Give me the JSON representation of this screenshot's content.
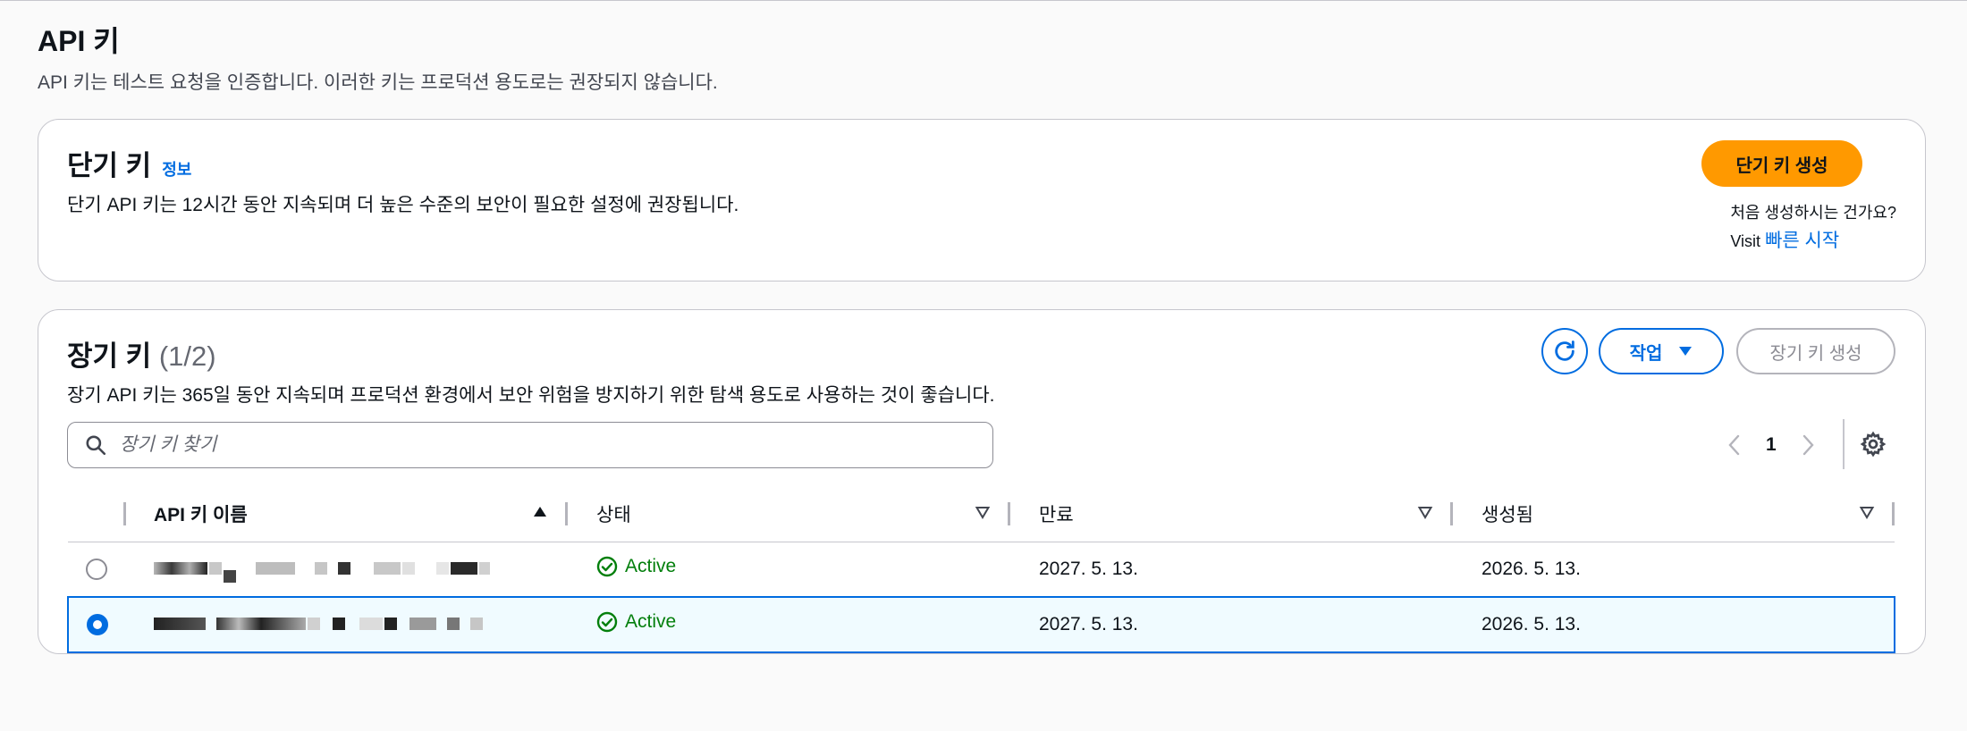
{
  "page": {
    "title": "API 키",
    "description": "API 키는 테스트 요청을 인증합니다. 이러한 키는 프로덕션 용도로는 권장되지 않습니다."
  },
  "short_keys": {
    "title": "단기 키",
    "info": "정보",
    "description": "단기 API 키는 12시간 동안 지속되며 더 높은 수준의 보안이 필요한 설정에 권장됩니다.",
    "create_button": "단기 키 생성",
    "first_time": "처음 생성하시는 건가요?",
    "visit_label": "Visit",
    "quick_start": "빠른 시작"
  },
  "long_keys": {
    "title": "장기 키",
    "count": "(1/2)",
    "description": "장기 API 키는 365일 동안 지속되며 프로덕션 환경에서 보안 위험을 방지하기 위한 탐색 용도로 사용하는 것이 좋습니다.",
    "action_button": "작업",
    "create_button": "장기 키 생성",
    "search_placeholder": "장기 키 찾기",
    "page_number": "1",
    "columns": {
      "name": "API 키 이름",
      "status": "상태",
      "expires": "만료",
      "created": "생성됨"
    },
    "rows": [
      {
        "selected": false,
        "status": "Active",
        "expires": "2027. 5. 13.",
        "created": "2026. 5. 13."
      },
      {
        "selected": true,
        "status": "Active",
        "expires": "2027. 5. 13.",
        "created": "2026. 5. 13."
      }
    ]
  },
  "colors": {
    "accent": "#006ce0",
    "primary_button": "#ff9900",
    "success": "#037f0c",
    "selected_row_bg": "#f0fbff"
  },
  "icons": [
    "refresh-icon",
    "caret-down-icon",
    "search-icon",
    "chevron-left-icon",
    "chevron-right-icon",
    "gear-icon",
    "sort-asc-icon",
    "sort-desc-icon",
    "status-check-icon"
  ]
}
